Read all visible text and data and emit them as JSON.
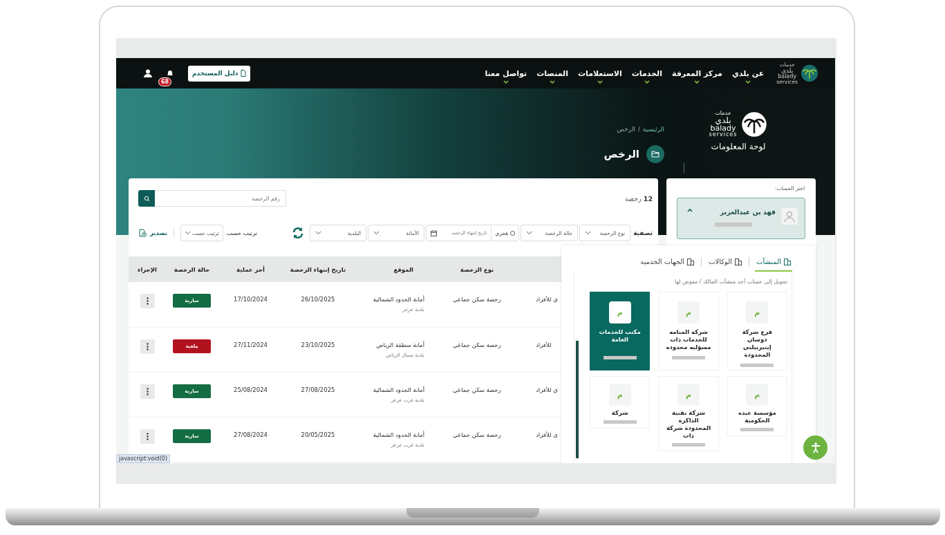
{
  "nav": {
    "logo_small": "خدمات",
    "logo_ar": "بلدي",
    "logo_en": "balady",
    "logo_sub": "services",
    "items": [
      {
        "label": "عن بلدي"
      },
      {
        "label": "مركز المعرفة"
      },
      {
        "label": "الخدمات"
      },
      {
        "label": "الاستعلامات"
      },
      {
        "label": "المنصات"
      },
      {
        "label": "تواصل معنا"
      }
    ],
    "guide_button": "دليل المستخدم",
    "notification_count": "68"
  },
  "hero": {
    "logo_small": "خدمات",
    "logo_ar": "بلدي",
    "logo_en": "balady",
    "logo_sub": "services",
    "dashboard_title": "لوحة المعلومات",
    "breadcrumb": [
      {
        "label": "الرئيسية"
      },
      {
        "label": "الرخص"
      }
    ],
    "breadcrumb_separator": "/",
    "page_title": "الرخص"
  },
  "account": {
    "label": "اختر الحساب:",
    "name": "فهد بن عبدالعزيز",
    "expanded": true
  },
  "account_menu": {
    "tabs": [
      {
        "label": "المنشآت",
        "selected": true
      },
      {
        "label": "الوكالات",
        "selected": false
      },
      {
        "label": "الجهات الخدمية",
        "selected": false
      }
    ],
    "hint": "تحويل إلى حساب أحد منشآت المالك / مفوض لها",
    "entities": [
      {
        "initial": "م",
        "name": "فرع شركة دوسان إينيربيلتي المحدودة",
        "selected": false
      },
      {
        "initial": "م",
        "name": "شركه المتامه للخدمات ذات مسؤليه محدوده",
        "selected": false
      },
      {
        "initial": "م",
        "name": "مكتب للخدمات العامة",
        "selected": true
      },
      {
        "initial": "م",
        "name": "مؤسسة عبده الحكومية",
        "selected": false
      },
      {
        "initial": "م",
        "name": "شركة تقنية الذاكرة المحدودة شركة ذات",
        "selected": false
      },
      {
        "initial": "م",
        "name": "شركة",
        "selected": false
      }
    ]
  },
  "licenses": {
    "count": "12",
    "count_label": "رخصة",
    "search": {
      "placeholder": "رقم الرخصة"
    },
    "filter_label": "تصفية",
    "filters": [
      {
        "kind": "select",
        "placeholder": "نوع الرخصة"
      },
      {
        "kind": "select",
        "placeholder": "حالة الرخصة"
      },
      {
        "kind": "date",
        "toggle_label": "هجري",
        "toggle_on": false,
        "placeholder": "تاريخ إنتهاء الرخصة"
      },
      {
        "kind": "select",
        "placeholder": "الأمانة"
      },
      {
        "kind": "select",
        "placeholder": "البلدية"
      }
    ],
    "sort_label": "ترتيب حسب",
    "sort_placeholder": "ترتيب حسب",
    "export_label": "تصدير",
    "columns": [
      "نوع الرخصة",
      "الموقع",
      "تاريخ إنتهاء الرخصة",
      "أخر عملية",
      "حالة الرخصة",
      "الإجراء"
    ],
    "rows": [
      {
        "column_1": "ي للأفراد",
        "type": "رخصة سكن جماعي",
        "location": "أمانة الحدود الشمالية",
        "sub_location": "بلدية عرعر",
        "expiry": "26/10/2025",
        "last_action": "17/10/2024",
        "status": "سارية",
        "color": "#146c43"
      },
      {
        "column_1": "للأفراد",
        "type": "رخصة سكن جماعي",
        "location": "أمانة منطقة الرياض",
        "sub_location": "بلدية شمال الرياض",
        "expiry": "23/10/2025",
        "last_action": "27/11/2024",
        "status": "ملغية",
        "color": "#b1121d"
      },
      {
        "column_1": "ي للأفراد",
        "type": "رخصة سكن جماعي",
        "location": "أمانة الحدود الشمالية",
        "sub_location": "بلدية غرب عرعر",
        "expiry": "27/08/2025",
        "last_action": "25/08/2024",
        "status": "سارية",
        "color": "#146c43"
      },
      {
        "column_1": "ى للأفراد",
        "type": "رخصة سكن جماعي",
        "location": "أمانة الحدود الشمالية",
        "sub_location": "بلدية غرب عرعر",
        "expiry": "20/05/2025",
        "last_action": "27/08/2024",
        "status": "سارية",
        "color": "#146c43"
      }
    ]
  },
  "status_link": "javascript:void(0)"
}
